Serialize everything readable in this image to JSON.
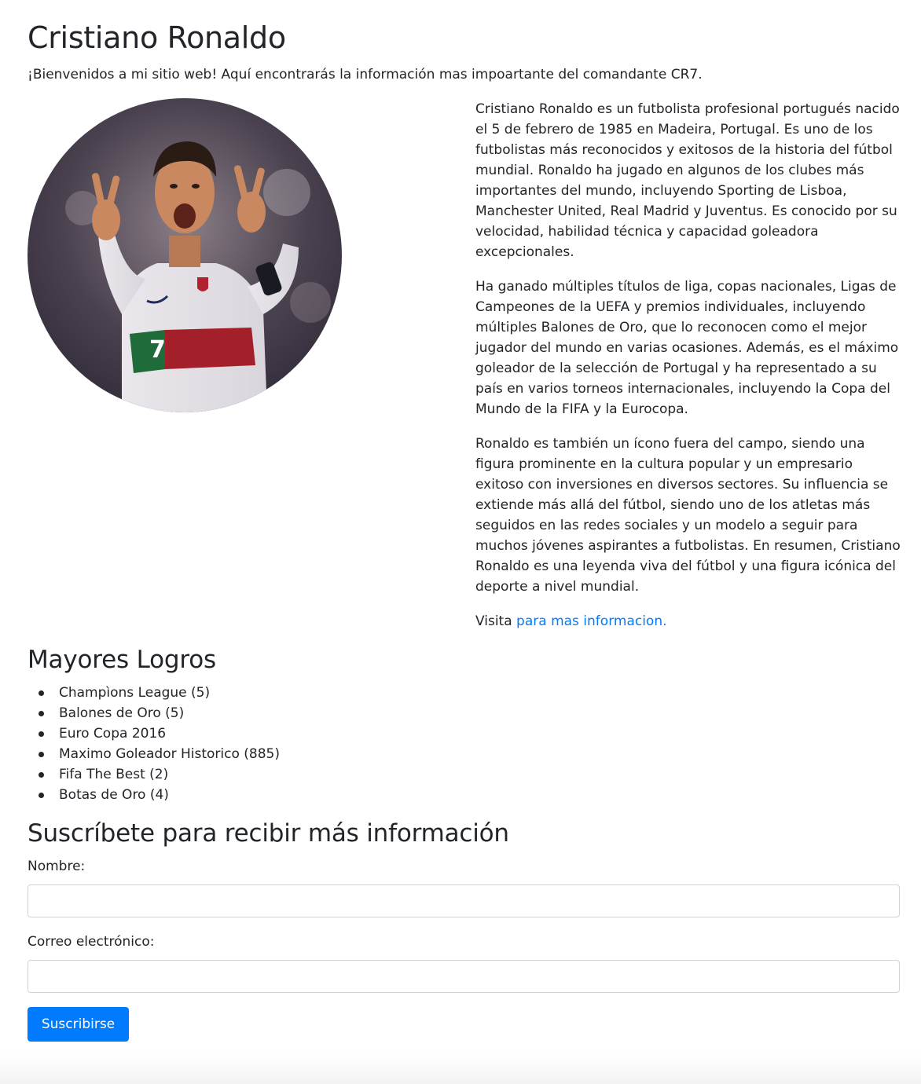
{
  "header": {
    "title": "Cristiano Ronaldo",
    "welcome": "¡Bienvenidos a mi sitio web! Aquí encontrarás la información mas impoartante del comandante CR7."
  },
  "profile": {
    "jersey_number": "7"
  },
  "bio": {
    "paragraphs": [
      "Cristiano Ronaldo es un futbolista profesional portugués nacido el 5 de febrero de 1985 en Madeira, Portugal. Es uno de los futbolistas más reconocidos y exitosos de la historia del fútbol mundial. Ronaldo ha jugado en algunos de los clubes más importantes del mundo, incluyendo Sporting de Lisboa, Manchester United, Real Madrid y Juventus. Es conocido por su velocidad, habilidad técnica y capacidad goleadora excepcionales.",
      "Ha ganado múltiples títulos de liga, copas nacionales, Ligas de Campeones de la UEFA y premios individuales, incluyendo múltiples Balones de Oro, que lo reconocen como el mejor jugador del mundo en varias ocasiones. Además, es el máximo goleador de la selección de Portugal y ha representado a su país en varios torneos internacionales, incluyendo la Copa del Mundo de la FIFA y la Eurocopa.",
      "Ronaldo es también un ícono fuera del campo, siendo una figura prominente en la cultura popular y un empresario exitoso con inversiones en diversos sectores. Su influencia se extiende más allá del fútbol, siendo uno de los atletas más seguidos en las redes sociales y un modelo a seguir para muchos jóvenes aspirantes a futbolistas. En resumen, Cristiano Ronaldo es una leyenda viva del fútbol y una figura icónica del deporte a nivel mundial."
    ],
    "visit_prefix": "Visita ",
    "visit_link": "para mas informacion."
  },
  "achievements": {
    "heading": "Mayores Logros",
    "items": [
      "Champìons League (5)",
      "Balones de Oro (5)",
      "Euro Copa 2016",
      "Maximo Goleador Historico (885)",
      "Fifa The Best (2)",
      "Botas de Oro (4)"
    ]
  },
  "subscribe": {
    "heading": "Suscríbete para recibir más información",
    "name_label": "Nombre:",
    "name_value": "",
    "email_label": "Correo electrónico:",
    "email_value": "",
    "submit_label": "Suscribirse"
  },
  "colors": {
    "link": "#007bff",
    "button": "#007bff",
    "text": "#212529"
  }
}
